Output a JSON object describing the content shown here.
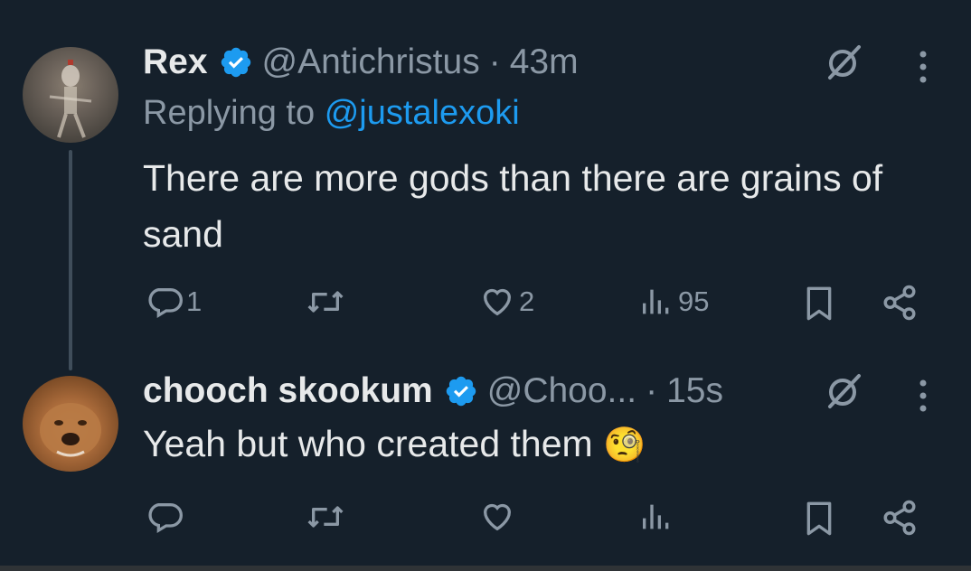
{
  "tweets": [
    {
      "name": "Rex",
      "handle": "@Antichristus",
      "separator": "·",
      "time": "43m",
      "replying_prefix": "Replying to",
      "replying_to": "@justalexoki",
      "text": "There are more gods than there are grains of sand",
      "actions": {
        "reply_count": "1",
        "retweet_count": "",
        "like_count": "2",
        "view_count": "95"
      }
    },
    {
      "name": "chooch skookum",
      "handle": "@Choo...",
      "separator": "·",
      "time": "15s",
      "text": "Yeah but who created them",
      "emoji": "🧐",
      "actions": {
        "reply_count": "",
        "retweet_count": "",
        "like_count": "",
        "view_count": ""
      }
    }
  ],
  "icons": {
    "verified": "verified-badge-icon",
    "grok": "grok-icon",
    "more": "more-options-icon",
    "reply": "reply-icon",
    "retweet": "retweet-icon",
    "like": "like-icon",
    "views": "views-icon",
    "bookmark": "bookmark-icon",
    "share": "share-icon"
  },
  "colors": {
    "background": "#15202b",
    "text": "#e7e9ea",
    "muted": "#8b98a5",
    "accent": "#1d9bf0"
  }
}
